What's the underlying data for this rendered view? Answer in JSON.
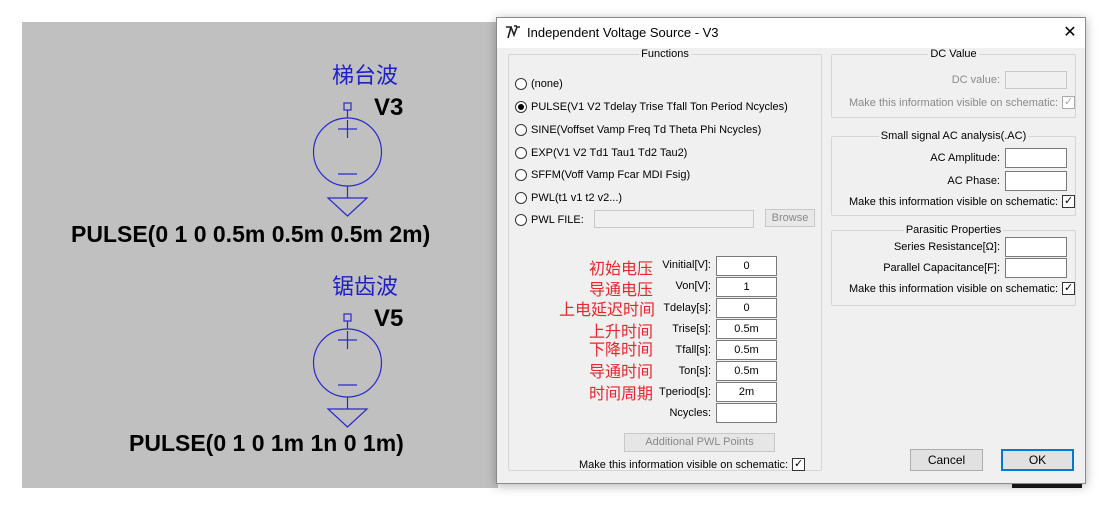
{
  "schematic": {
    "v3": {
      "cn_label": "梯台波",
      "name": "V3",
      "value": "PULSE(0 1 0 0.5m 0.5m 0.5m 2m)"
    },
    "v5": {
      "cn_label": "锯齿波",
      "name": "V5",
      "value": "PULSE(0 1 0 1m 1n 0 1m)"
    }
  },
  "dialog": {
    "title": "Independent Voltage Source - V3",
    "close_glyph": "✕",
    "functions": {
      "legend": "Functions",
      "options": [
        {
          "label": "(none)",
          "selected": false
        },
        {
          "label": "PULSE(V1 V2 Tdelay Trise Tfall Ton Period Ncycles)",
          "selected": true
        },
        {
          "label": "SINE(Voffset Vamp Freq Td Theta Phi Ncycles)",
          "selected": false
        },
        {
          "label": "EXP(V1 V2 Td1 Tau1 Td2 Tau2)",
          "selected": false
        },
        {
          "label": "SFFM(Voff Vamp Fcar MDI Fsig)",
          "selected": false
        },
        {
          "label": "PWL(t1 v1 t2 v2...)",
          "selected": false
        },
        {
          "label": "PWL FILE:",
          "selected": false
        }
      ],
      "browse_label": "Browse",
      "add_pwl_label": "Additional PWL Points",
      "visible_label": "Make this information visible on schematic:",
      "visible_checked": "✓"
    },
    "params": [
      {
        "cn": "初始电压",
        "label": "Vinitial[V]:",
        "value": "0"
      },
      {
        "cn": "导通电压",
        "label": "Von[V]:",
        "value": "1"
      },
      {
        "cn": "上电延迟时间",
        "label": "Tdelay[s]:",
        "value": "0"
      },
      {
        "cn": "上升时间",
        "label": "Trise[s]:",
        "value": "0.5m"
      },
      {
        "cn": "下降时间",
        "label": "Tfall[s]:",
        "value": "0.5m"
      },
      {
        "cn": "导通时间",
        "label": "Ton[s]:",
        "value": "0.5m"
      },
      {
        "cn": "时间周期",
        "label": "Tperiod[s]:",
        "value": "2m"
      },
      {
        "cn": "",
        "label": "Ncycles:",
        "value": ""
      }
    ],
    "dc": {
      "legend": "DC Value",
      "value_label": "DC value:",
      "visible_label": "Make this information visible on schematic:",
      "visible_checked": "✓"
    },
    "ac": {
      "legend": "Small signal AC analysis(.AC)",
      "amplitude_label": "AC Amplitude:",
      "phase_label": "AC Phase:",
      "visible_label": "Make this information visible on schematic:",
      "visible_checked": "✓"
    },
    "parasitic": {
      "legend": "Parasitic Properties",
      "series_label": "Series Resistance[Ω]:",
      "parallel_label": "Parallel Capacitance[F]:",
      "visible_label": "Make this information visible on schematic:",
      "visible_checked": "✓"
    },
    "cancel_label": "Cancel",
    "ok_label": "OK"
  },
  "colors": {
    "schematic_bg": "#c0c0c0",
    "wire": "#2a2acc",
    "cn_annotation": "#e8262b",
    "ok_border": "#0078d7"
  }
}
